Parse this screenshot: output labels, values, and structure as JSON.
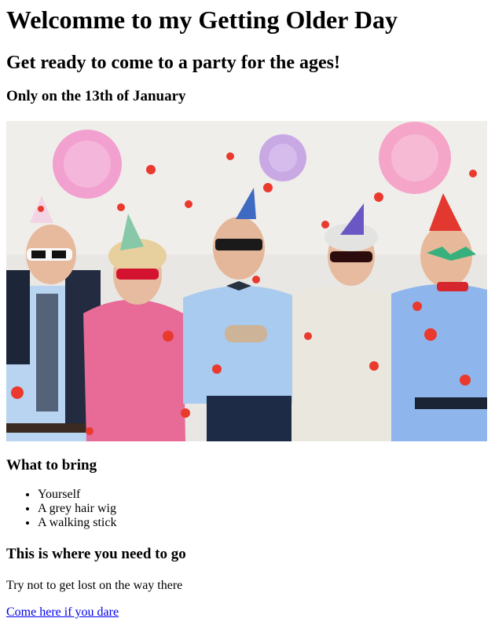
{
  "header": {
    "title": "Welcomme to my Getting Older Day",
    "subtitle": "Get ready to come to a party for the ages!",
    "date_line": "Only on the 13th of January"
  },
  "hero_image": {
    "alt": "Five seniors in party hats and novelty glasses surrounded by confetti and paper decorations"
  },
  "bring": {
    "heading": "What to bring",
    "items": [
      "Yourself",
      "A grey hair wig",
      "A walking stick"
    ]
  },
  "location": {
    "heading": "This is where you need to go",
    "note": "Try not to get lost on the way there",
    "link_text": "Come here if you dare"
  },
  "colors": {
    "link": "#0000ee"
  }
}
